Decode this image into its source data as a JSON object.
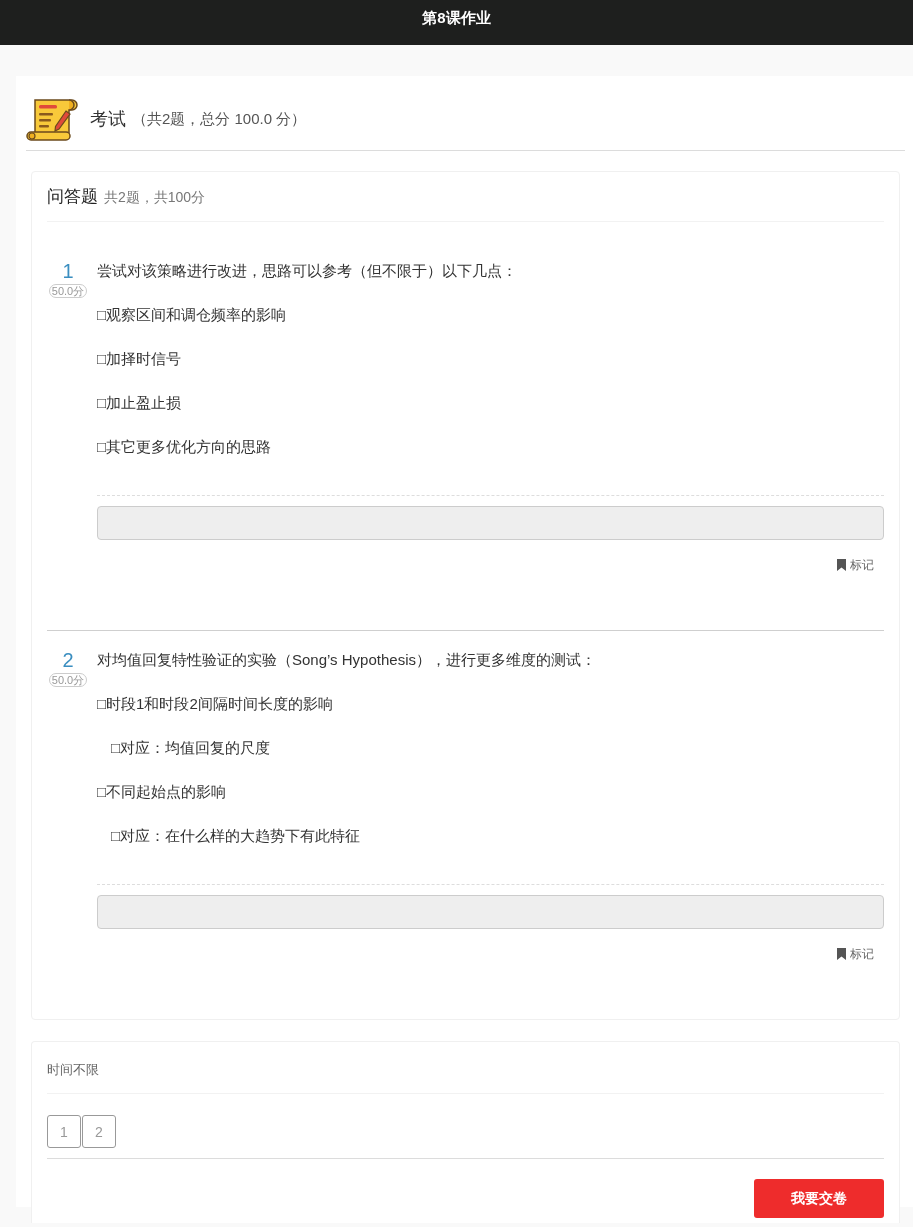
{
  "header": {
    "title": "第8课作业"
  },
  "exam": {
    "title": "考试",
    "summary": "（共2题，总分 100.0 分）"
  },
  "section": {
    "title": "问答题",
    "summary": "共2题，共100分"
  },
  "questions": [
    {
      "number": "1",
      "score": "50.0分",
      "prompt": "尝试对该策略进行改进，思路可以参考（但不限于）以下几点：",
      "items": [
        {
          "text": "□观察区间和调仓频率的影响"
        },
        {
          "text": "□加择时信号"
        },
        {
          "text": "□加止盈止损"
        },
        {
          "text": "□其它更多优化方向的思路"
        }
      ],
      "mark_label": "标记"
    },
    {
      "number": "2",
      "score": "50.0分",
      "prompt": "对均值回复特性验证的实验（Song’s Hypothesis），进行更多维度的测试：",
      "items": [
        {
          "text": "□时段1和时段2间隔时间长度的影响",
          "children": [
            {
              "text": "□对应：均值回复的尺度"
            }
          ]
        },
        {
          "text": "□不同起始点的影响",
          "children": [
            {
              "text": "□对应：在什么样的大趋势下有此特征"
            }
          ]
        }
      ],
      "mark_label": "标记"
    }
  ],
  "footer": {
    "time_limit": "时间不限",
    "pages": [
      {
        "label": "1",
        "selected": false
      },
      {
        "label": "2",
        "selected": false
      }
    ],
    "submit": "我要交卷"
  }
}
